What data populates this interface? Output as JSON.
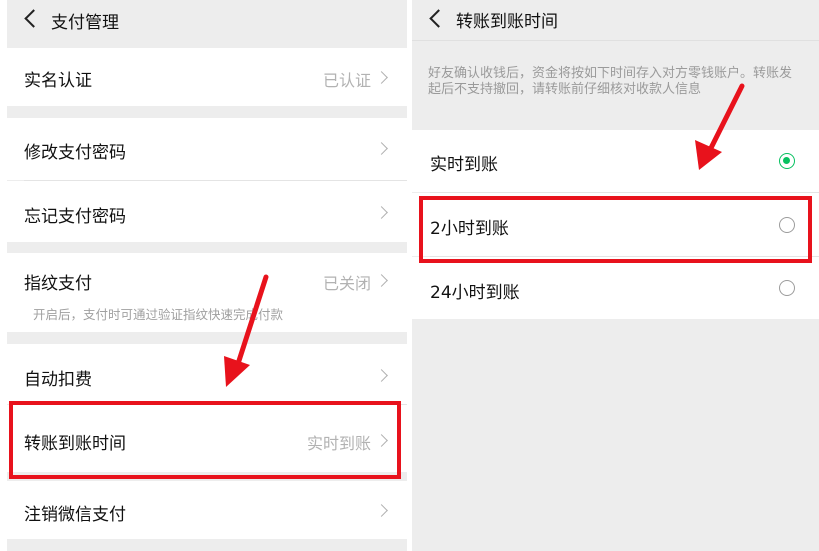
{
  "left": {
    "header": {
      "title": "支付管理"
    },
    "items": [
      {
        "label": "实名认证",
        "value": "已认证"
      },
      {
        "label": "修改支付密码"
      },
      {
        "label": "忘记支付密码"
      },
      {
        "label": "指纹支付",
        "value": "已关闭",
        "sub": "开启后，支付时可通过验证指纹快速完成付款"
      },
      {
        "label": "自动扣费"
      },
      {
        "label": "转账到账时间",
        "value": "实时到账"
      },
      {
        "label": "注销微信支付"
      }
    ]
  },
  "right": {
    "header": {
      "title": "转账到账时间"
    },
    "description": "好友确认收钱后，资金将按如下时间存入对方零钱账户。转账发起后不支持撤回，请转账前仔细核对收款人信息",
    "options": [
      {
        "label": "实时到账",
        "selected": true
      },
      {
        "label": "2小时到账",
        "selected": false
      },
      {
        "label": "24小时到账",
        "selected": false
      }
    ]
  },
  "colors": {
    "accent": "#07c160",
    "highlight": "#e8121c"
  }
}
